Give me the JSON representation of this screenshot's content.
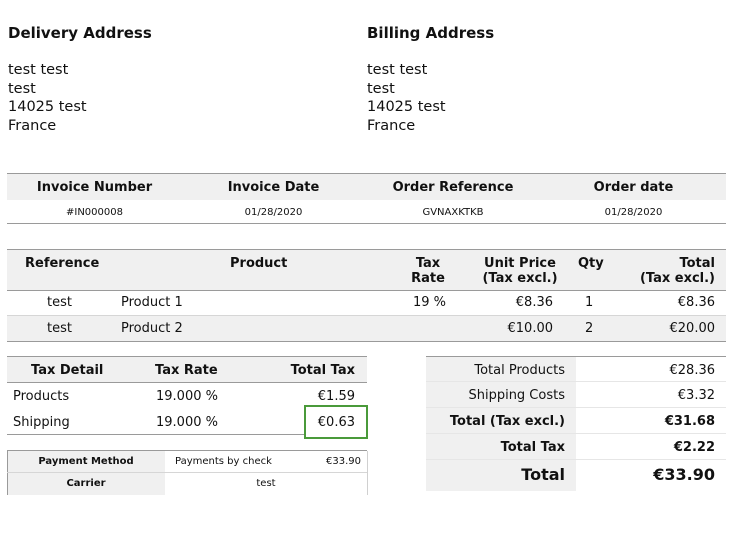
{
  "delivery": {
    "title": "Delivery Address",
    "lines": [
      "test test",
      "test",
      "14025 test",
      "France"
    ]
  },
  "billing": {
    "title": "Billing Address",
    "lines": [
      "test test",
      "test",
      "14025 test",
      "France"
    ]
  },
  "invoice_info": {
    "headers": [
      "Invoice Number",
      "Invoice Date",
      "Order Reference",
      "Order date"
    ],
    "values": [
      "#IN000008",
      "01/28/2020",
      "GVNAXKTKB",
      "01/28/2020"
    ]
  },
  "products": {
    "headers": {
      "reference": "Reference",
      "product": "Product",
      "tax_rate_1": "Tax",
      "tax_rate_2": "Rate",
      "unit_price_1": "Unit Price",
      "unit_price_2": "(Tax excl.)",
      "qty": "Qty",
      "total_1": "Total",
      "total_2": "(Tax excl.)"
    },
    "rows": [
      {
        "reference": "test",
        "product": "Product 1",
        "tax_rate": "19 %",
        "unit_price": "€8.36",
        "qty": "1",
        "total": "€8.36"
      },
      {
        "reference": "test",
        "product": "Product 2",
        "tax_rate": "",
        "unit_price": "€10.00",
        "qty": "2",
        "total": "€20.00"
      }
    ]
  },
  "tax_detail": {
    "headers": [
      "Tax Detail",
      "Tax Rate",
      "Total Tax"
    ],
    "rows": [
      {
        "label": "Products",
        "rate": "19.000 %",
        "total": "€1.59"
      },
      {
        "label": "Shipping",
        "rate": "19.000 %",
        "total": "€0.63"
      }
    ]
  },
  "payment": {
    "method_label": "Payment Method",
    "method_value": "Payments by check",
    "method_amount": "€33.90",
    "carrier_label": "Carrier",
    "carrier_value": "test"
  },
  "totals": {
    "total_products_label": "Total Products",
    "total_products": "€28.36",
    "shipping_label": "Shipping Costs",
    "shipping": "€3.32",
    "tax_excl_label": "Total (Tax excl.)",
    "tax_excl": "€31.68",
    "total_tax_label": "Total Tax",
    "total_tax": "€2.22",
    "total_label": "Total",
    "total": "€33.90"
  },
  "colors": {
    "highlight": "#4a9a3a",
    "header_bg": "#f0f0f0"
  }
}
